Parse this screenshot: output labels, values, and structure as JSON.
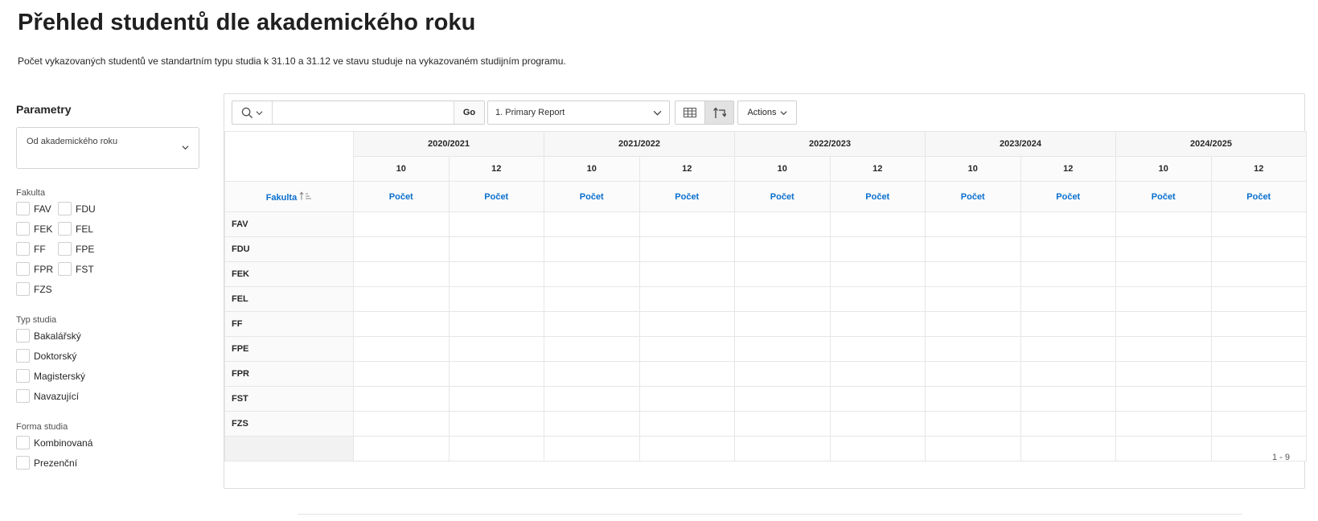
{
  "page": {
    "title": "Přehled studentů dle akademického roku",
    "description": "Počet vykazovaných studentů ve standartním typu studia k 31.10 a 31.12 ve stavu studuje na vykazovaném studijním programu."
  },
  "sidebar": {
    "title": "Parametry",
    "year_select": {
      "label": "Od akademického roku"
    },
    "fakulta": {
      "label": "Fakulta",
      "items": [
        "FAV",
        "FDU",
        "FEK",
        "FEL",
        "FF",
        "FPE",
        "FPR",
        "FST",
        "FZS"
      ]
    },
    "typ_studia": {
      "label": "Typ studia",
      "items": [
        "Bakalářský",
        "Doktorský",
        "Magisterský",
        "Navazující"
      ]
    },
    "forma_studia": {
      "label": "Forma studia",
      "items": [
        "Kombinovaná",
        "Prezenční"
      ]
    }
  },
  "toolbar": {
    "search_value": "",
    "go_label": "Go",
    "report_select": "1. Primary Report",
    "actions_label": "Actions"
  },
  "pivot": {
    "years": [
      "2020/2021",
      "2021/2022",
      "2022/2023",
      "2023/2024",
      "2024/2025"
    ],
    "months": [
      "10",
      "12",
      "10",
      "12",
      "10",
      "12",
      "10",
      "12",
      "10",
      "12"
    ],
    "metrics": [
      "Počet",
      "Počet",
      "Počet",
      "Počet",
      "Počet",
      "Počet",
      "Počet",
      "Počet",
      "Počet",
      "Počet"
    ],
    "row_header": "Fakulta",
    "rows": [
      "FAV",
      "FDU",
      "FEK",
      "FEL",
      "FF",
      "FPE",
      "FPR",
      "FST",
      "FZS"
    ]
  },
  "pagination": {
    "range": "1 - 9"
  },
  "colors": {
    "accent": "#0a6fce",
    "border": "#dcdcdc"
  }
}
